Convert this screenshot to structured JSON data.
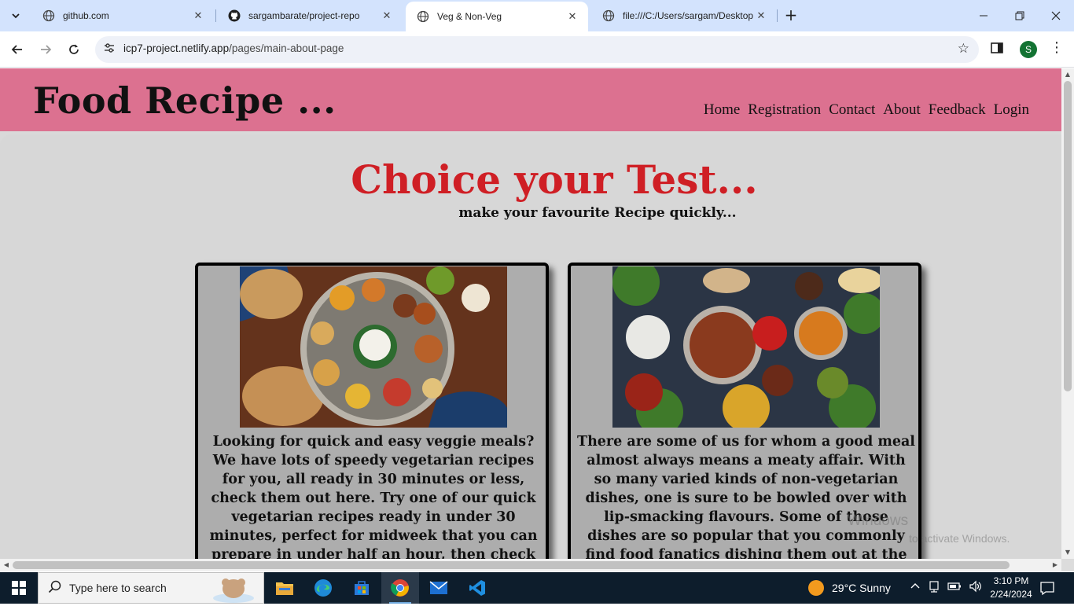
{
  "browser": {
    "tabs": [
      {
        "title": "github.com",
        "active": false
      },
      {
        "title": "sargambarate/project-repo",
        "active": false
      },
      {
        "title": "Veg & Non-Veg",
        "active": true
      },
      {
        "title": "file:///C:/Users/sargam/Desktop",
        "active": false
      }
    ],
    "url_domain": "icp7-project.netlify.app",
    "url_path": "/pages/main-about-page",
    "profile_initial": "S"
  },
  "site": {
    "brand": "Food Recipe ...",
    "nav": [
      "Home",
      "Registration",
      "Contact",
      "About",
      "Feedback",
      "Login"
    ],
    "headline": "Choice your Test...",
    "subline": "make your favourite Recipe quickly...",
    "cards": [
      {
        "name": "veg",
        "image_alt": "Vegetarian thali with rotis, rice, curries and chutneys",
        "text": "Looking for quick and easy veggie meals? We have lots of speedy vegetarian recipes for you, all ready in 30 minutes or less, check them out here. Try one of our quick vegetarian recipes ready in under 30 minutes, perfect for midweek that you can prepare in under half an hour, then check out more of our quick recipes."
      },
      {
        "name": "nonveg",
        "image_alt": "Spread of non-vegetarian dishes with curries, kebabs and rice",
        "text": "There are some of us for whom a good meal almost always means a meaty affair. With so many varied kinds of non-vegetarian dishes, one is sure to be bowled over with lip-smacking flavours. Some of those dishes are so popular that you commonly find food fanatics dishing them out at the comfort of their kitchen."
      }
    ]
  },
  "watermark": {
    "line1": "Windows",
    "line2": "to activate Windows."
  },
  "taskbar": {
    "search_placeholder": "Type here to search",
    "weather": "29°C  Sunny",
    "time": "3:10 PM",
    "date": "2/24/2024"
  },
  "colors": {
    "header_bg": "#dc7190",
    "headline": "#cf1f25",
    "card_bg": "#adadad",
    "page_bg": "#d7d7d7"
  }
}
